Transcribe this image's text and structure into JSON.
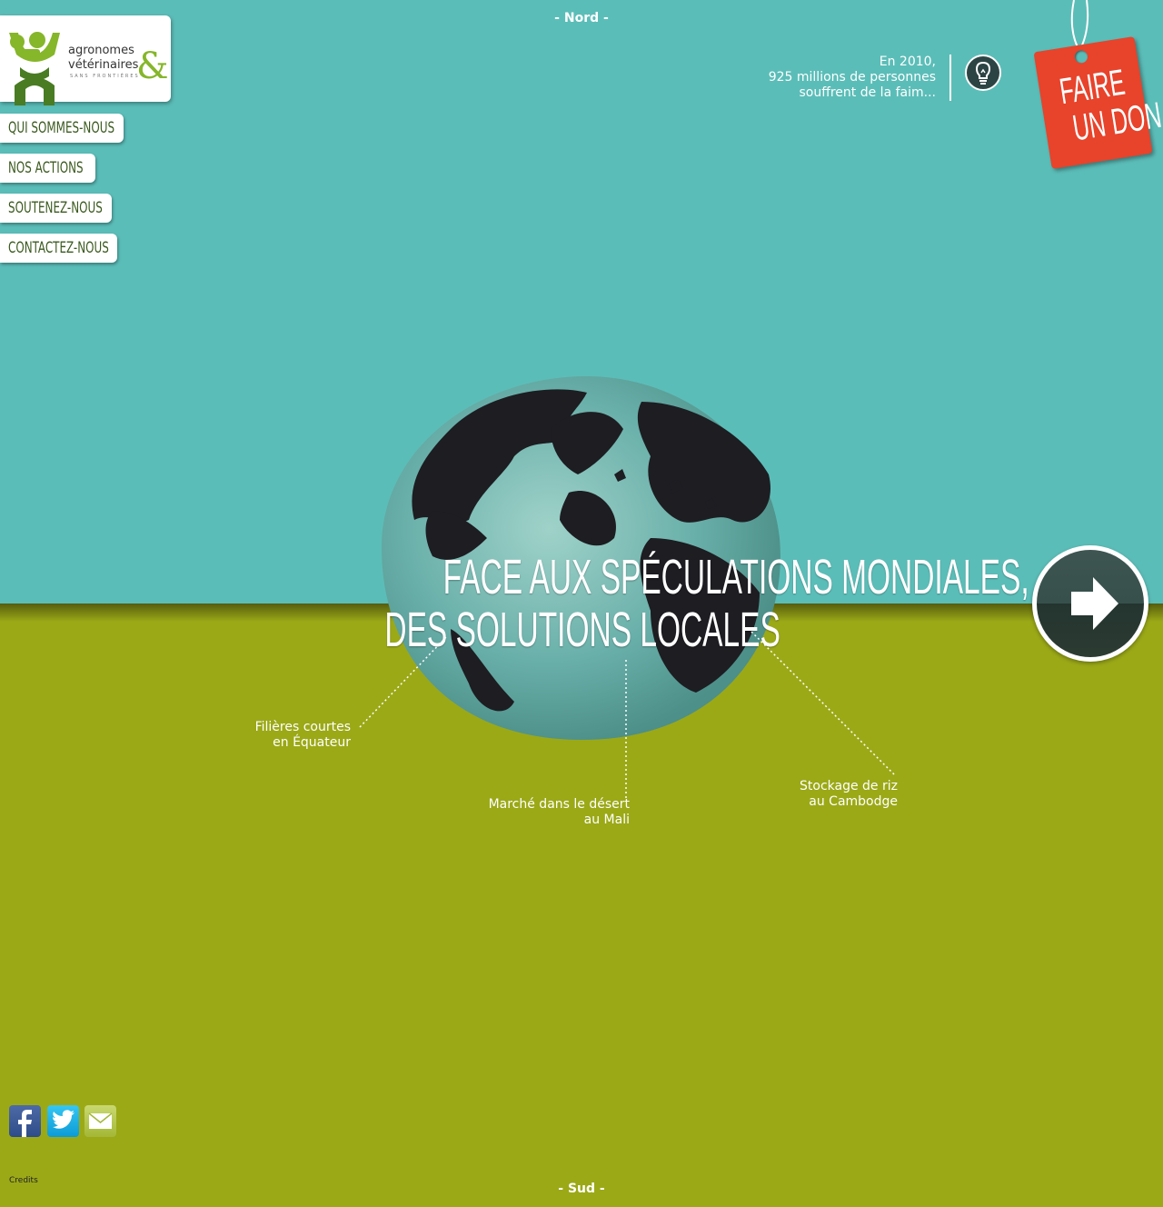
{
  "compass": {
    "north": "- Nord -",
    "south": "- Sud -"
  },
  "logo": {
    "line1": "agronomes",
    "line2": "vétérinaires",
    "ampersand": "&",
    "tagline": "SANS FRONTIÈRES"
  },
  "menu": [
    {
      "label": "Qui sommes-nous"
    },
    {
      "label": "Nos actions"
    },
    {
      "label": "Soutenez-nous"
    },
    {
      "label": "Contactez-nous"
    }
  ],
  "stat": {
    "line1": "En 2010,",
    "line2": "925 millions de personnes",
    "line3": "souffrent de la faim..."
  },
  "donate": {
    "line1": "FAIRE",
    "line2": "UN DON"
  },
  "headline": {
    "line1": "FACE AUX SPÉCULATIONS MONDIALES,",
    "line2": "DES SOLUTIONS LOCALES"
  },
  "annotations": [
    {
      "line1": "Filières courtes",
      "line2": "en Équateur"
    },
    {
      "line1": "Marché dans le désert",
      "line2": "au Mali"
    },
    {
      "line1": "Stockage de riz",
      "line2": "au Cambodge"
    }
  ],
  "footer": {
    "credits": "Credits"
  },
  "colors": {
    "sky": "#5bbdb8",
    "ground": "#9ba917",
    "donate": "#e8432b",
    "menu_text": "#3b5a1e",
    "logo_green": "#86b62a"
  },
  "icons": {
    "bulb": "lightbulb-icon",
    "next": "arrow-right-icon",
    "facebook": "facebook-icon",
    "twitter": "twitter-icon",
    "email": "email-icon"
  }
}
